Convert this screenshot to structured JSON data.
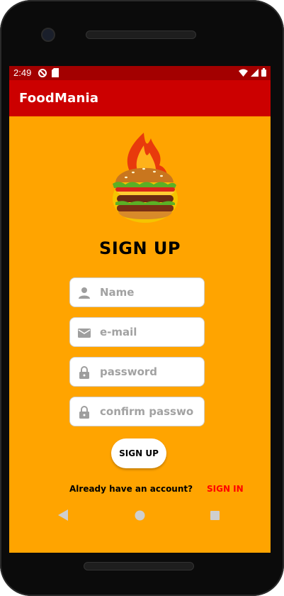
{
  "status_bar": {
    "time": "2:49"
  },
  "app_bar": {
    "title": "FoodMania"
  },
  "form": {
    "heading": "SIGN UP",
    "name_placeholder": "Name",
    "email_placeholder": "e-mail",
    "password_placeholder": "password",
    "confirm_placeholder": "confirm passwo",
    "submit_label": "SIGN UP"
  },
  "footer": {
    "prompt": "Already have an account?",
    "signin_label": "SIGN IN"
  },
  "colors": {
    "background": "#ffa400",
    "app_bar": "#cc0000",
    "status_bar": "#a30000",
    "link": "#ff0000"
  }
}
